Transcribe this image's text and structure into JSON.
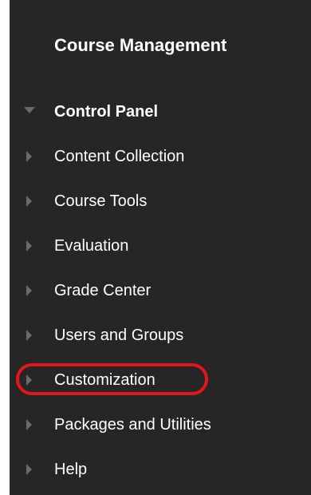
{
  "colors": {
    "panel_background": "#262626",
    "text": "#ffffff",
    "arrow": "#6b6b6b",
    "highlight": "#e3161c"
  },
  "course_management": {
    "title": "Course Management"
  },
  "control_panel": {
    "label": "Control Panel",
    "expanded_icon": "triangle-down-icon",
    "items": [
      {
        "label": "Content Collection",
        "icon": "triangle-right-icon"
      },
      {
        "label": "Course Tools",
        "icon": "triangle-right-icon"
      },
      {
        "label": "Evaluation",
        "icon": "triangle-right-icon"
      },
      {
        "label": "Grade Center",
        "icon": "triangle-right-icon"
      },
      {
        "label": "Users and Groups",
        "icon": "triangle-right-icon"
      },
      {
        "label": "Customization",
        "icon": "triangle-right-icon",
        "highlighted": true
      },
      {
        "label": "Packages and Utilities",
        "icon": "triangle-right-icon"
      },
      {
        "label": "Help",
        "icon": "triangle-right-icon"
      }
    ]
  }
}
